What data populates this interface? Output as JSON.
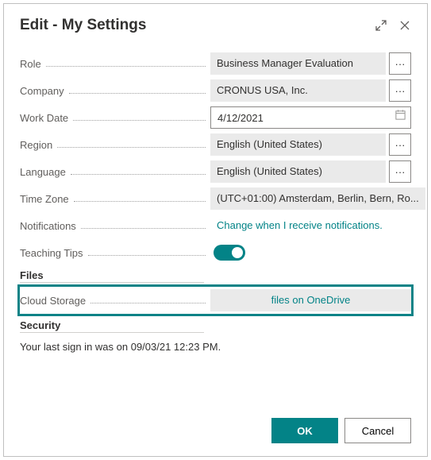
{
  "header": {
    "title": "Edit - My Settings"
  },
  "fields": {
    "role": {
      "label": "Role",
      "value": "Business Manager Evaluation"
    },
    "company": {
      "label": "Company",
      "value": "CRONUS USA, Inc."
    },
    "workDate": {
      "label": "Work Date",
      "value": "4/12/2021"
    },
    "region": {
      "label": "Region",
      "value": "English (United States)"
    },
    "language": {
      "label": "Language",
      "value": "English (United States)"
    },
    "timeZone": {
      "label": "Time Zone",
      "value": "(UTC+01:00) Amsterdam, Berlin, Bern, Ro..."
    },
    "notifications": {
      "label": "Notifications",
      "value": "Change when I receive notifications."
    },
    "teachingTips": {
      "label": "Teaching Tips"
    },
    "cloudStorage": {
      "label": "Cloud Storage",
      "value": "files on OneDrive"
    }
  },
  "sections": {
    "files": "Files",
    "security": "Security"
  },
  "securityText": "Your last sign in was on 09/03/21 12:23 PM.",
  "buttons": {
    "ok": "OK",
    "cancel": "Cancel"
  }
}
